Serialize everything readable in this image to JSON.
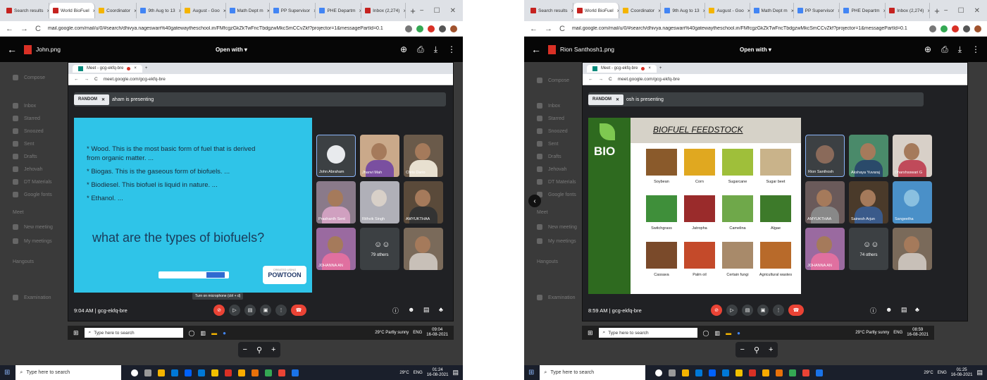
{
  "left": {
    "tabs": [
      "Search results",
      "World BioFuel",
      "Coordinator",
      "9th Aug to 13",
      "August - Goo",
      "Math Dept m",
      "PP Supervisor",
      "PHE Departm",
      "Inbox (2,274)"
    ],
    "url": "mail.google.com/mail/u/0/#search/dhivya.nageswari%40gatewaytheschool.in/FMfcgzGkZkTwFncTbdgzwMkcSmCCvZkf?projector=1&messagePartId=0.1",
    "filename": "John.png",
    "open_with": "Open with",
    "meet_tab": "Meet - gcg-ekfq-bre",
    "meet_url": "meet.google.com/gcg-ekfq-bre",
    "random_label": "RANDOM",
    "presenting": "aham is presenting",
    "slide": {
      "bullets": [
        "Wood. This is the most basic form of fuel that is derived from organic matter. ...",
        "Biogas. This is the gaseous form of biofuels. ...",
        "Biodiesel. This biofuel is liquid in nature. ...",
        "Ethanol. ..."
      ],
      "question": "what are the types of biofuels?",
      "powtoon": "POWTOON",
      "powtoon_small": "CREATED USING"
    },
    "tiles": [
      "John Abraham",
      "Jhanvi Mah",
      "Chris Dario",
      "Prashanth Sent",
      "Rithvik Singh",
      "AMYUKTHAA",
      "JOHANNA AN",
      "79 others",
      ""
    ],
    "time": "9:04 AM",
    "meeting_code": "gcg-ekfq-bre",
    "tooltip": "Turn on microphone (ctrl + d)",
    "inner_search": "Type here to search",
    "weather": "29°C Partly sunny",
    "inner_lang": "ENG",
    "inner_clock_time": "09:04",
    "inner_clock_date": "16-08-2021",
    "sidebar": [
      "Compose",
      "Inbox",
      "Starred",
      "Snoozed",
      "Sent",
      "Drafts",
      "Jehovah",
      "DT Materials",
      "Google fonts",
      "Meet",
      "New meeting",
      "My meetings",
      "Hangouts",
      "Examination"
    ],
    "taskbar_search": "Type here to search",
    "taskbar_weather": "29°C",
    "taskbar_lang": "ENG",
    "taskbar_time": "01:24",
    "taskbar_date": "16-08-2021"
  },
  "right": {
    "tabs": [
      "Search results",
      "World BioFuel",
      "Coordinator",
      "9th Aug to 13",
      "August - Goo",
      "Math Dept m",
      "PP Supervisor",
      "PHE Departm",
      "Inbox (2,274)"
    ],
    "url": "mail.google.com/mail/u/0/#search/dhivya.nageswari%40gatewaytheschool.in/FMfcgzGkZkTwFncTbdgzwMkcSmCCvZkf?projector=1&messagePartId=0.1",
    "filename": "Rion Santhosh1.png",
    "open_with": "Open with",
    "meet_tab": "Meet - gcg-ekfq-bre",
    "meet_url": "meet.google.com/gcg-ekfq-bre",
    "random_label": "RANDOM",
    "presenting": "osh is presenting",
    "slide": {
      "bio": "BIO",
      "title": "BIOFUEL FEEDSTOCK",
      "items": [
        "Soybean",
        "Corn",
        "Sugarcane",
        "Sugar beet",
        "Switchgrass",
        "Jatropha",
        "Camelina",
        "Algae",
        "Cassava",
        "Palm oil",
        "Certain fungi",
        "Agricultural wastes"
      ],
      "colors": [
        "#8a5a2b",
        "#e0a820",
        "#9fbf3a",
        "#c9b38a",
        "#3f8f3a",
        "#9a2b2b",
        "#6fa84a",
        "#3d7a2a",
        "#7a4a2a",
        "#c44a2a",
        "#a88a6a",
        "#b86a2a"
      ]
    },
    "tiles": [
      "Rion Santhosh",
      "Akshaya Yuvaraj",
      "Dharshsswari G",
      "AMYUKTHAA",
      "Sainesh Arjun",
      "Sangeetha",
      "JOHANNA AN",
      "74 others",
      ""
    ],
    "time": "8:59 AM",
    "meeting_code": "gcg-ekfq-bre",
    "inner_search": "Type here to search",
    "weather": "29°C Partly sunny",
    "inner_lang": "ENG",
    "inner_clock_time": "08:59",
    "inner_clock_date": "16-08-2021",
    "sidebar": [
      "Compose",
      "Inbox",
      "Starred",
      "Snoozed",
      "Sent",
      "Drafts",
      "Jehovah",
      "DT Materials",
      "Google fonts",
      "Meet",
      "New meeting",
      "My meetings",
      "Hangouts",
      "Examination"
    ],
    "taskbar_search": "Type here to search",
    "taskbar_weather": "29°C",
    "taskbar_lang": "ENG",
    "taskbar_time": "01:25",
    "taskbar_date": "16-08-2021"
  }
}
